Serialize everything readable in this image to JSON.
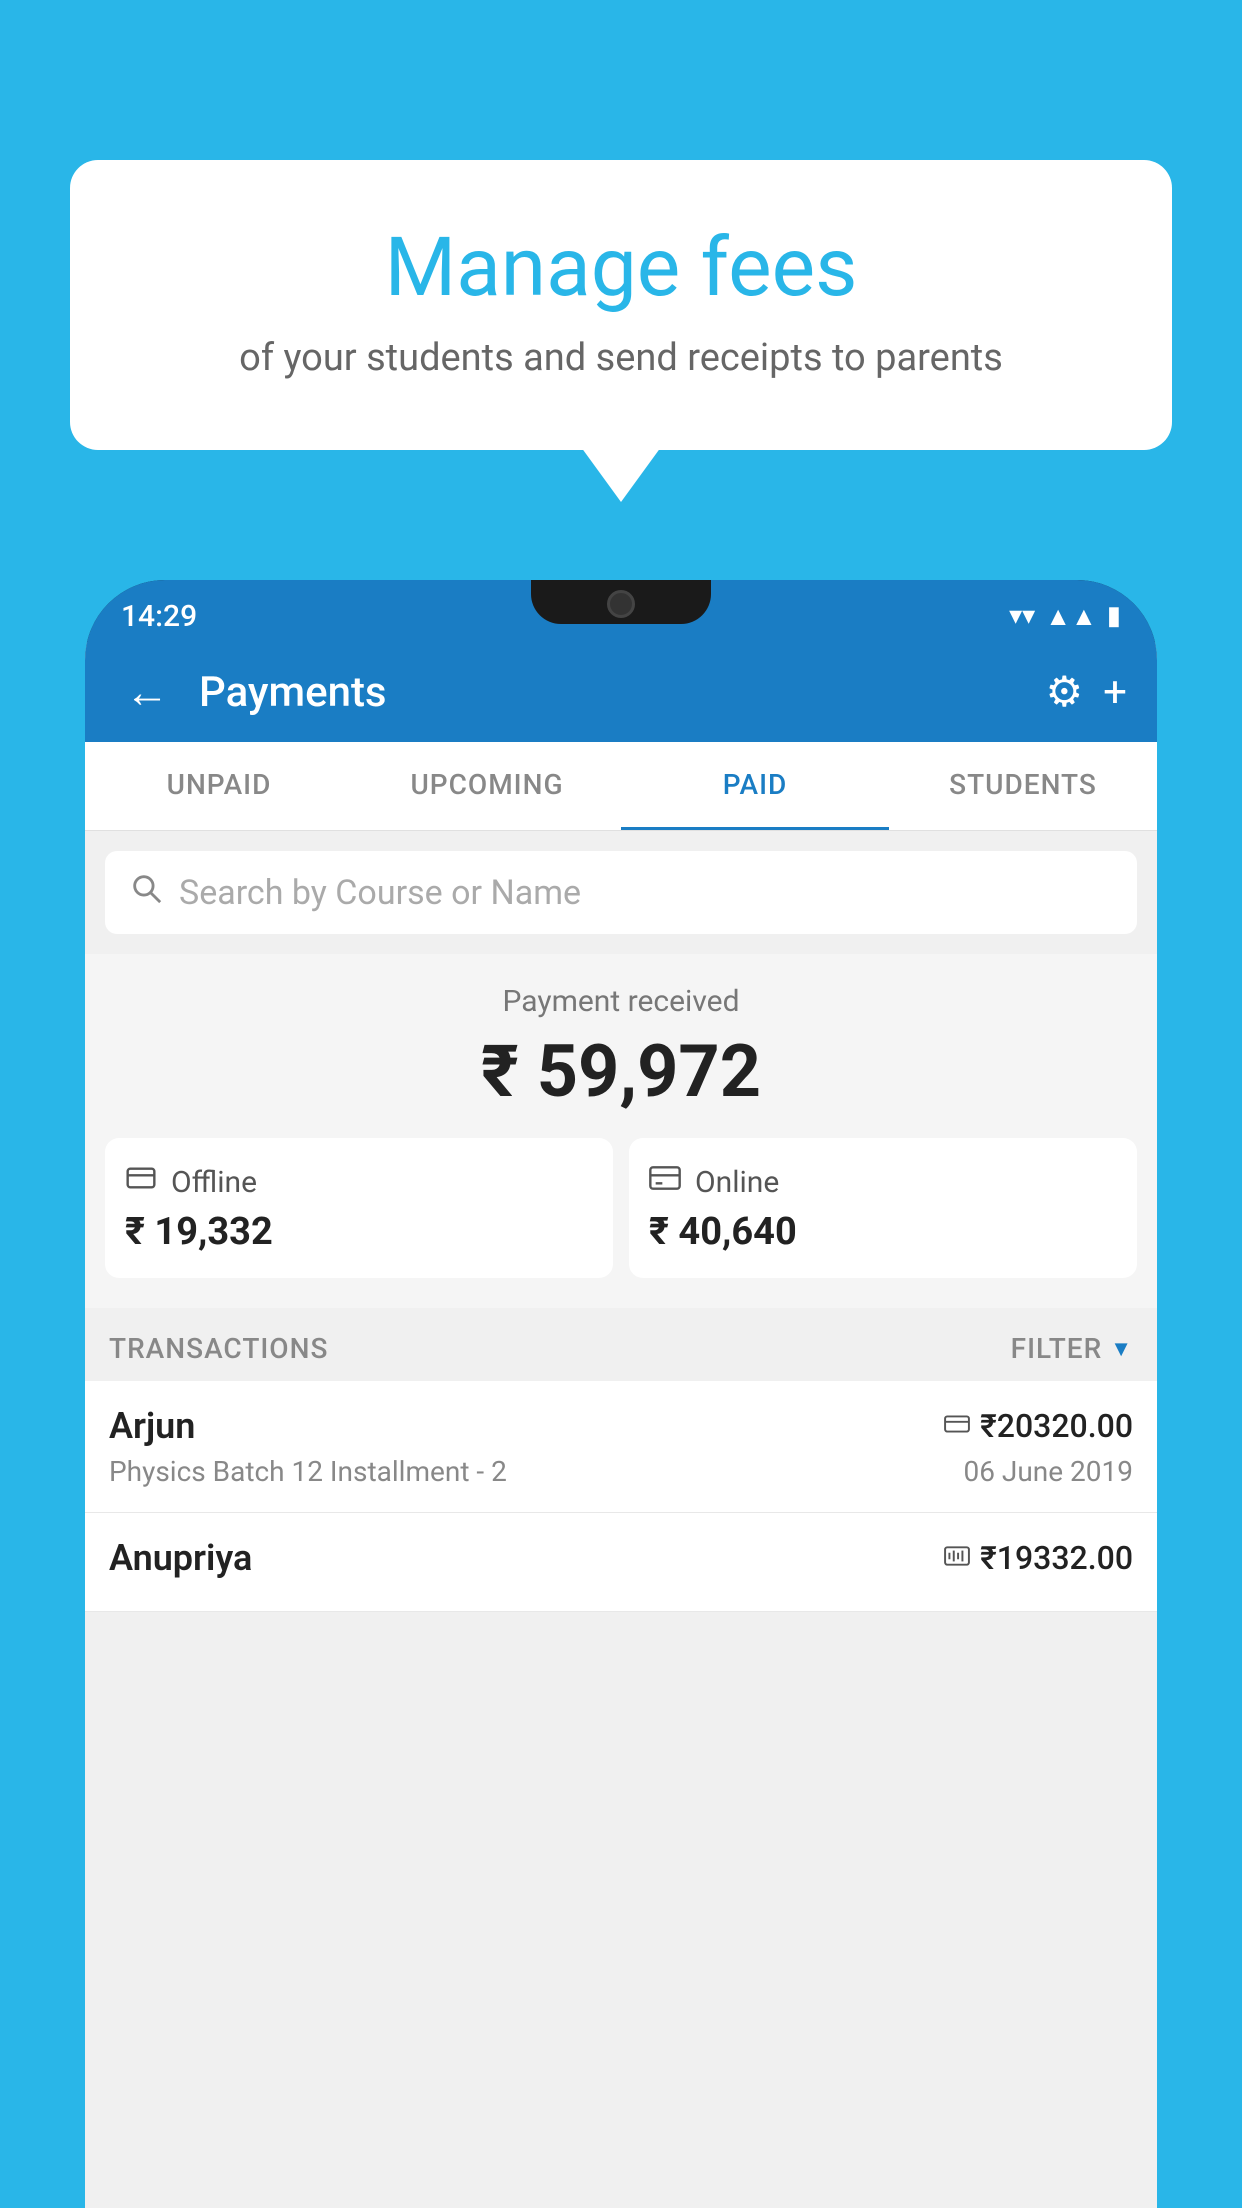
{
  "background_color": "#29b6e8",
  "bubble": {
    "title": "Manage fees",
    "subtitle": "of your students and send receipts to parents"
  },
  "phone": {
    "status_bar": {
      "time": "14:29",
      "icons": [
        "wifi",
        "signal",
        "battery"
      ]
    },
    "app_bar": {
      "title": "Payments",
      "back_label": "←",
      "settings_label": "⚙",
      "add_label": "+"
    },
    "tabs": [
      {
        "label": "UNPAID",
        "active": false
      },
      {
        "label": "UPCOMING",
        "active": false
      },
      {
        "label": "PAID",
        "active": true
      },
      {
        "label": "STUDENTS",
        "active": false
      }
    ],
    "search": {
      "placeholder": "Search by Course or Name"
    },
    "payment_section": {
      "label": "Payment received",
      "amount": "₹ 59,972",
      "offline": {
        "label": "Offline",
        "amount": "₹ 19,332"
      },
      "online": {
        "label": "Online",
        "amount": "₹ 40,640"
      }
    },
    "transactions": {
      "label": "TRANSACTIONS",
      "filter_label": "FILTER",
      "rows": [
        {
          "name": "Arjun",
          "course": "Physics Batch 12 Installment - 2",
          "amount": "₹20320.00",
          "date": "06 June 2019",
          "type": "online"
        },
        {
          "name": "Anupriya",
          "course": "",
          "amount": "₹19332.00",
          "date": "",
          "type": "offline"
        }
      ]
    }
  }
}
